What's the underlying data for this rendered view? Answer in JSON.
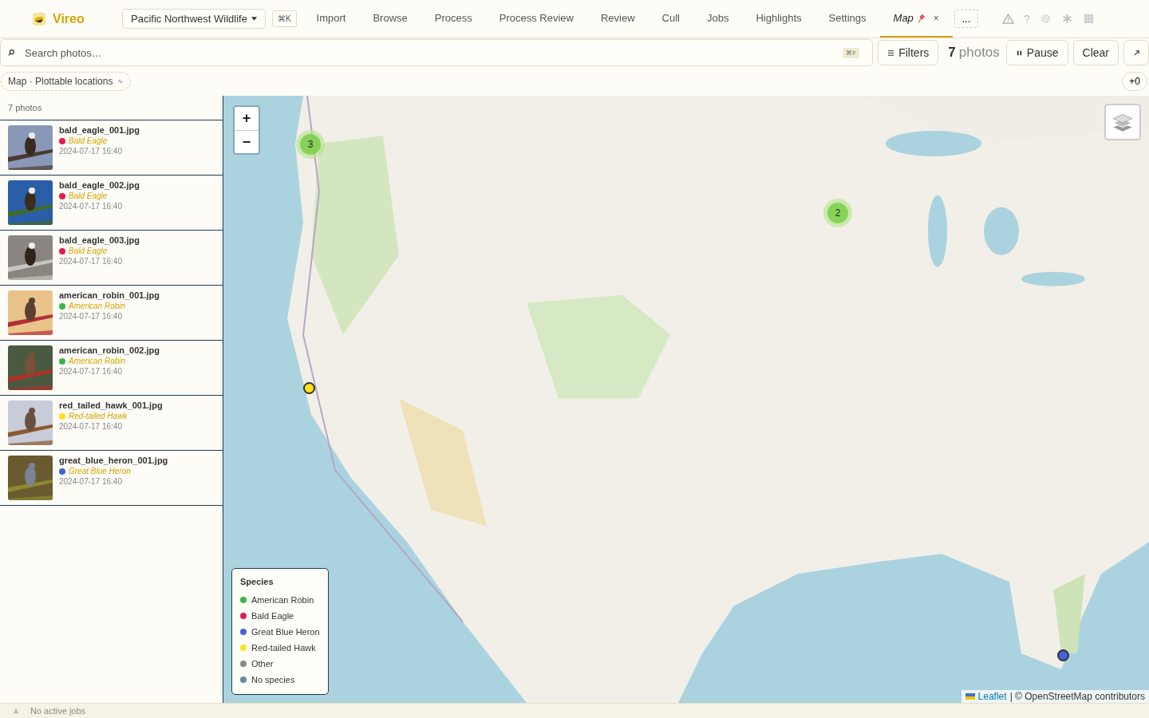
{
  "app": {
    "name": "Vireo"
  },
  "project_selector": {
    "label": "Pacific Northwest Wildlife"
  },
  "shortcut_key": "⌘K",
  "tabs": [
    {
      "label": "Import",
      "selected": false,
      "pinned": false
    },
    {
      "label": "Browse",
      "selected": false,
      "pinned": false
    },
    {
      "label": "Process",
      "selected": false,
      "pinned": false
    },
    {
      "label": "Process Review",
      "selected": false,
      "pinned": false
    },
    {
      "label": "Review",
      "selected": false,
      "pinned": false
    },
    {
      "label": "Cull",
      "selected": false,
      "pinned": false
    },
    {
      "label": "Jobs",
      "selected": false,
      "pinned": false
    },
    {
      "label": "Highlights",
      "selected": false,
      "pinned": false
    },
    {
      "label": "Settings",
      "selected": false,
      "pinned": false
    },
    {
      "label": "Map",
      "selected": true,
      "pinned": true,
      "close": "×"
    }
  ],
  "more_tabs": "...",
  "help": "?",
  "search": {
    "placeholder": "Search photos…",
    "shortcut": "⌘F"
  },
  "filters_button": "Filters",
  "count": {
    "number": "7",
    "label": "photos"
  },
  "pause_button": "Pause",
  "clear_button": "Clear",
  "view_chip": "Map · Plottable locations",
  "offset_badge": "+0",
  "sidebar": {
    "count": "7 photos",
    "photos": [
      {
        "file": "bald_eagle_001.jpg",
        "species": "Bald Eagle",
        "color": "#e8194a",
        "date": "2024-07-17 16:40"
      },
      {
        "file": "bald_eagle_002.jpg",
        "species": "Bald Eagle",
        "color": "#e8194a",
        "date": "2024-07-17 16:40"
      },
      {
        "file": "bald_eagle_003.jpg",
        "species": "Bald Eagle",
        "color": "#e8194a",
        "date": "2024-07-17 16:40"
      },
      {
        "file": "american_robin_001.jpg",
        "species": "American Robin",
        "color": "#3cb44b",
        "date": "2024-07-17 16:40"
      },
      {
        "file": "american_robin_002.jpg",
        "species": "American Robin",
        "color": "#3cb44b",
        "date": "2024-07-17 16:40"
      },
      {
        "file": "red_tailed_hawk_001.jpg",
        "species": "Red-tailed Hawk",
        "color": "#ffe119",
        "date": "2024-07-17 16:40"
      },
      {
        "file": "great_blue_heron_001.jpg",
        "species": "Great Blue Heron",
        "color": "#4363d8",
        "date": "2024-07-17 16:40"
      }
    ]
  },
  "map": {
    "zoom_in": "+",
    "zoom_out": "−",
    "clusters": [
      {
        "count": "3"
      },
      {
        "count": "2"
      }
    ],
    "markers": [
      {
        "color": "#ffe119"
      },
      {
        "color": "#4363d8"
      }
    ],
    "legend": {
      "title": "Species",
      "items": [
        {
          "label": "American Robin",
          "color": "#3cb44b"
        },
        {
          "label": "Bald Eagle",
          "color": "#e8194a"
        },
        {
          "label": "Great Blue Heron",
          "color": "#4363d8"
        },
        {
          "label": "Red-tailed Hawk",
          "color": "#ffe119"
        },
        {
          "label": "Other",
          "color": "#888888"
        },
        {
          "label": "No species",
          "color": "#5b8fa8"
        }
      ]
    },
    "attribution": {
      "link": "Leaflet",
      "text": "| © OpenStreetMap contributors"
    }
  },
  "status_bar": {
    "text": "No active jobs"
  }
}
